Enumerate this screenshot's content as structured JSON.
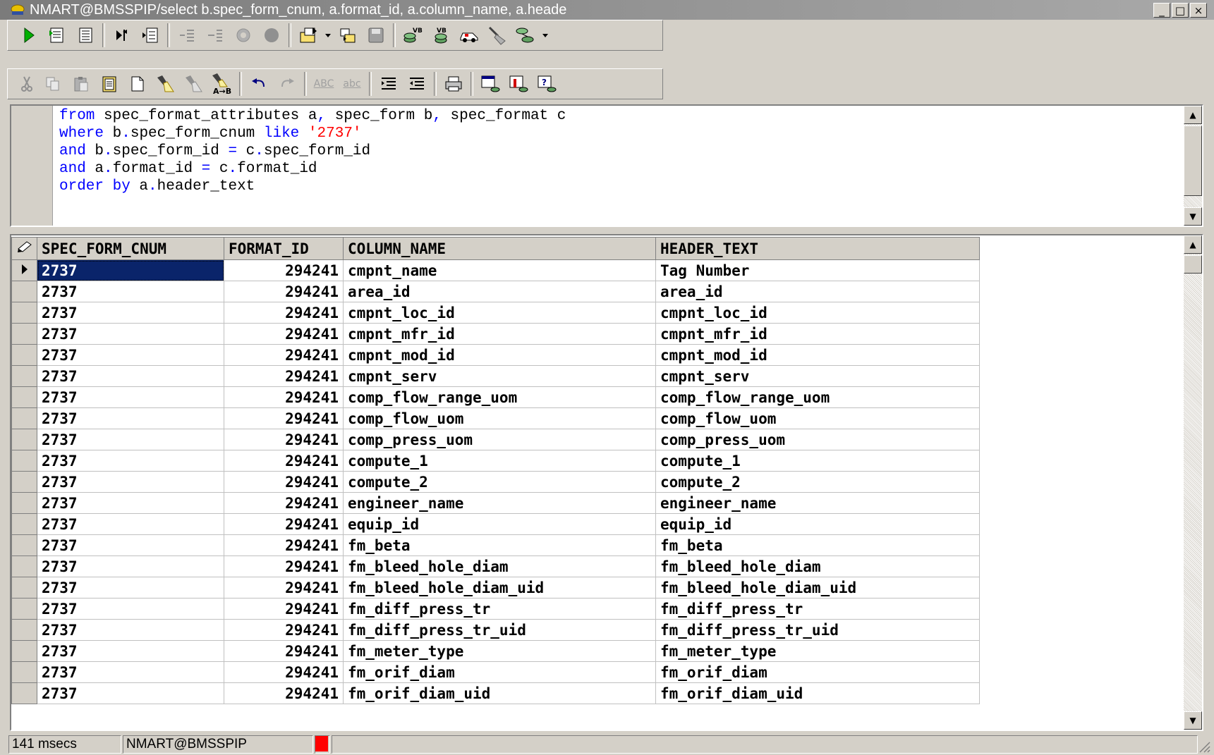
{
  "window": {
    "title": "NMART@BMSSPIP/select b.spec_form_cnum, a.format_id, a.column_name, a.heade",
    "controls": [
      "_",
      "□",
      "×"
    ]
  },
  "toolbar1": {
    "icons": [
      "execute-icon",
      "execute-script-icon",
      "explain-script-icon",
      "step-icon",
      "explain-plan-icon",
      "indent-icon",
      "outdent-icon",
      "disabled-icon-1",
      "disabled-icon-2",
      "load-icon",
      "load-dropdown-icon",
      "save-as-icon",
      "save-icon",
      "vb-wizard-icon",
      "vb-convert-icon",
      "car-icon",
      "broom-icon",
      "db-link-icon",
      "db-dropdown-icon"
    ]
  },
  "toolbar2": {
    "icons": [
      "cut-icon",
      "copy-icon",
      "paste-icon",
      "paste-special-icon",
      "new-icon",
      "flashlight-icon",
      "find-next-icon",
      "replace-icon",
      "undo-icon",
      "redo-icon",
      "uppercase-icon",
      "lowercase-icon",
      "indent-block-icon",
      "unindent-block-icon",
      "print-icon",
      "grid-icon-1",
      "grid-icon-2",
      "grid-help-icon"
    ],
    "uppercase_label": "ABC",
    "lowercase_label": "abc",
    "replace_label": "A→B"
  },
  "editor": {
    "lines": [
      [
        {
          "t": "from",
          "k": "kw"
        },
        {
          "t": " spec_format_attributes a",
          "k": ""
        },
        {
          "t": ",",
          "k": "kw"
        },
        {
          "t": " spec_form b",
          "k": ""
        },
        {
          "t": ",",
          "k": "kw"
        },
        {
          "t": " spec_format c",
          "k": ""
        }
      ],
      [
        {
          "t": "where",
          "k": "kw"
        },
        {
          "t": " b",
          "k": ""
        },
        {
          "t": ".",
          "k": "kw"
        },
        {
          "t": "spec_form_cnum ",
          "k": ""
        },
        {
          "t": "like",
          "k": "kw"
        },
        {
          "t": " ",
          "k": ""
        },
        {
          "t": "'2737'",
          "k": "str"
        }
      ],
      [
        {
          "t": "and",
          "k": "kw"
        },
        {
          "t": " b",
          "k": ""
        },
        {
          "t": ".",
          "k": "kw"
        },
        {
          "t": "spec_form_id ",
          "k": ""
        },
        {
          "t": "=",
          "k": "kw"
        },
        {
          "t": " c",
          "k": ""
        },
        {
          "t": ".",
          "k": "kw"
        },
        {
          "t": "spec_form_id",
          "k": ""
        }
      ],
      [
        {
          "t": "and",
          "k": "kw"
        },
        {
          "t": " a",
          "k": ""
        },
        {
          "t": ".",
          "k": "kw"
        },
        {
          "t": "format_id ",
          "k": ""
        },
        {
          "t": "=",
          "k": "kw"
        },
        {
          "t": " c",
          "k": ""
        },
        {
          "t": ".",
          "k": "kw"
        },
        {
          "t": "format_id",
          "k": ""
        }
      ],
      [
        {
          "t": "order by",
          "k": "kw"
        },
        {
          "t": " a",
          "k": ""
        },
        {
          "t": ".",
          "k": "kw"
        },
        {
          "t": "header_text",
          "k": ""
        }
      ]
    ]
  },
  "grid": {
    "columns": [
      "SPEC_FORM_CNUM",
      "FORMAT_ID",
      "COLUMN_NAME",
      "HEADER_TEXT"
    ],
    "rows": [
      [
        "2737",
        "294241",
        "cmpnt_name",
        "Tag Number"
      ],
      [
        "2737",
        "294241",
        "area_id",
        "area_id"
      ],
      [
        "2737",
        "294241",
        "cmpnt_loc_id",
        "cmpnt_loc_id"
      ],
      [
        "2737",
        "294241",
        "cmpnt_mfr_id",
        "cmpnt_mfr_id"
      ],
      [
        "2737",
        "294241",
        "cmpnt_mod_id",
        "cmpnt_mod_id"
      ],
      [
        "2737",
        "294241",
        "cmpnt_serv",
        "cmpnt_serv"
      ],
      [
        "2737",
        "294241",
        "comp_flow_range_uom",
        "comp_flow_range_uom"
      ],
      [
        "2737",
        "294241",
        "comp_flow_uom",
        "comp_flow_uom"
      ],
      [
        "2737",
        "294241",
        "comp_press_uom",
        "comp_press_uom"
      ],
      [
        "2737",
        "294241",
        "compute_1",
        "compute_1"
      ],
      [
        "2737",
        "294241",
        "compute_2",
        "compute_2"
      ],
      [
        "2737",
        "294241",
        "engineer_name",
        "engineer_name"
      ],
      [
        "2737",
        "294241",
        "equip_id",
        "equip_id"
      ],
      [
        "2737",
        "294241",
        "fm_beta",
        "fm_beta"
      ],
      [
        "2737",
        "294241",
        "fm_bleed_hole_diam",
        "fm_bleed_hole_diam"
      ],
      [
        "2737",
        "294241",
        "fm_bleed_hole_diam_uid",
        "fm_bleed_hole_diam_uid"
      ],
      [
        "2737",
        "294241",
        "fm_diff_press_tr",
        "fm_diff_press_tr"
      ],
      [
        "2737",
        "294241",
        "fm_diff_press_tr_uid",
        "fm_diff_press_tr_uid"
      ],
      [
        "2737",
        "294241",
        "fm_meter_type",
        "fm_meter_type"
      ],
      [
        "2737",
        "294241",
        "fm_orif_diam",
        "fm_orif_diam"
      ],
      [
        "2737",
        "294241",
        "fm_orif_diam_uid",
        "fm_orif_diam_uid"
      ]
    ],
    "selected_row": 0
  },
  "status": {
    "elapsed": "141 msecs",
    "connection": "NMART@BMSSPIP",
    "indicator_color": "#ff0000"
  },
  "colors": {
    "keyword": "#0000ff",
    "string": "#ff0000",
    "selection": "#0a246a"
  }
}
